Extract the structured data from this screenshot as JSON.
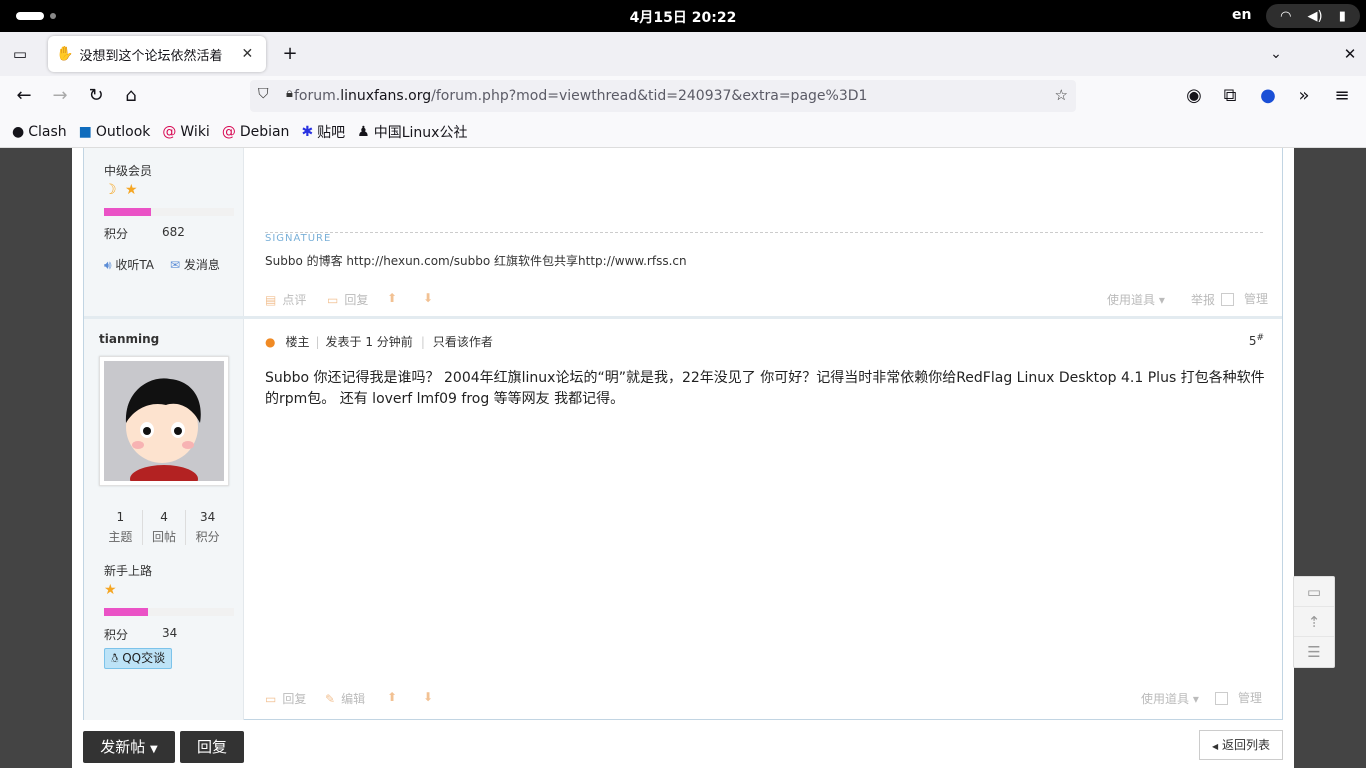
{
  "system": {
    "clock": "4月15日  20:22",
    "lang": "en"
  },
  "tab": {
    "title": "没想到这个论坛依然活着"
  },
  "address": {
    "scheme_host_pre": "forum.",
    "host": "linuxfans.org",
    "path": "/forum.php?mod=viewthread&tid=240937&extra=page%3D1"
  },
  "bookmarks": [
    {
      "label": "Clash"
    },
    {
      "label": "Outlook"
    },
    {
      "label": "Wiki"
    },
    {
      "label": "Debian"
    },
    {
      "label": "贴吧"
    },
    {
      "label": "中国Linux公社"
    }
  ],
  "prev_post": {
    "rank": "中级会员",
    "points_label": "积分",
    "points": "682",
    "progress": 0.36,
    "follow_label": "收听TA",
    "message_label": "发消息",
    "signature_heading": "SIGNATURE",
    "signature": "Subbo 的博客 http://hexun.com/subbo 红旗软件包共享http://www.rfss.cn",
    "actions": {
      "comment": "点评",
      "reply": "回复",
      "tools": "使用道具",
      "report": "举报",
      "manage": "管理"
    }
  },
  "post": {
    "author": "tianming",
    "role": "楼主",
    "posted": "发表于 1 分钟前",
    "only_author": "只看该作者",
    "floor": "5",
    "floor_sup": "#",
    "stats": [
      {
        "value": "1",
        "label": "主题"
      },
      {
        "value": "4",
        "label": "回帖"
      },
      {
        "value": "34",
        "label": "积分"
      }
    ],
    "rank": "新手上路",
    "points_label": "积分",
    "points": "34",
    "progress": 0.34,
    "qq_label": "QQ交谈",
    "body_line1": "Subbo 你还记得我是谁吗？ 2004年红旗linux论坛的“明”就是我，22年没见了 你可好？记得当时非常依赖你给RedFlag Linux Desktop 4.1 Plus 打包各种软件",
    "body_line2": "的rpm包。 还有 loverf lmf09 frog 等等网友 我都记得。",
    "actions": {
      "reply": "回复",
      "edit": "编辑",
      "tools": "使用道具",
      "manage": "管理"
    }
  },
  "bottom": {
    "new_post": "发新帖",
    "reply": "回复",
    "back_to_list": "返回列表"
  },
  "colors": {
    "accent": "#ea52c6",
    "link": "#369",
    "signature": "#7ab0d8"
  }
}
